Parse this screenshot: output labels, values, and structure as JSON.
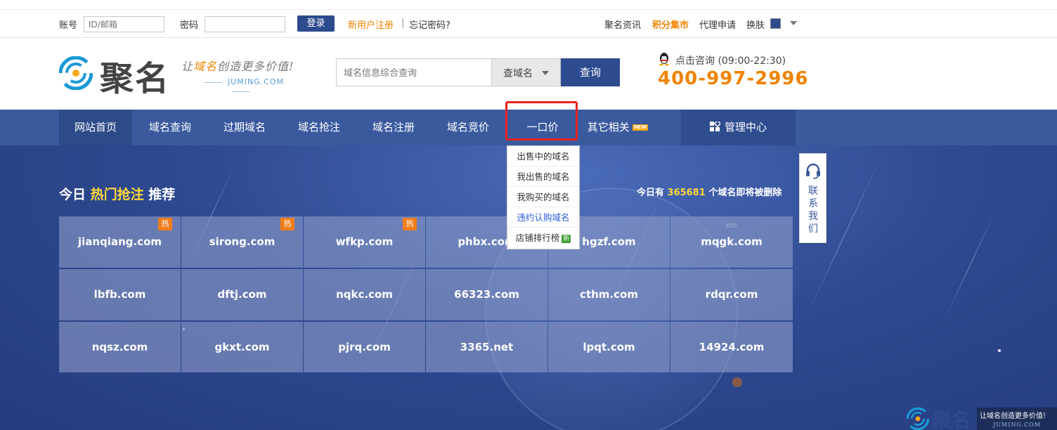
{
  "topbar": {
    "username_label": "账号",
    "username_placeholder": "ID/邮箱",
    "password_label": "密码",
    "login_button": "登录",
    "register_link": "新用户注册",
    "forgot_link": "忘记密码?",
    "news_link": "聚名资讯",
    "points_link": "积分集市",
    "agent_link": "代理申请",
    "skin_label": "换肤",
    "skin_color": "#2d4b8e"
  },
  "header": {
    "logo_text": "聚名",
    "slogan_prefix": "让",
    "slogan_highlight": "域名",
    "slogan_suffix": "创造更多价值!",
    "slogan_domain": "JUMING.COM",
    "search_placeholder": "域名信息综合查询",
    "search_type": "查域名",
    "search_button": "查询",
    "consult_text": "点击咨询",
    "consult_hours": "(09:00-22:30)",
    "phone": "400-997-2996"
  },
  "nav": {
    "items": [
      "网站首页",
      "域名查询",
      "过期域名",
      "域名抢注",
      "域名注册",
      "域名竞价",
      "一口价",
      "其它相关"
    ],
    "new_badge": "NEW",
    "manage": "管理中心"
  },
  "dropdown": {
    "items": [
      "出售中的域名",
      "我出售的域名",
      "我购买的域名",
      "违约认购域名",
      "店铺排行榜"
    ],
    "new_tag": "新"
  },
  "banner": {
    "title_prefix": "今日 ",
    "title_highlight": "热门抢注",
    "title_suffix": " 推荐",
    "count_prefix": "今日有 ",
    "count_value": "365681",
    "count_suffix": " 个域名即将被删除",
    "hot_tag": "热",
    "domains": [
      "jianqiang.com",
      "sirong.com",
      "wfkp.com",
      "phbx.com",
      "hgzf.com",
      "mqgk.com",
      "lbfb.com",
      "dftj.com",
      "nqkc.com",
      "66323.com",
      "cthm.com",
      "rdqr.com",
      "nqsz.com",
      "gkxt.com",
      "pjrq.com",
      "3365.net",
      "lpqt.com",
      "14924.com"
    ],
    "bg_text": "xin"
  },
  "contact": {
    "label": "联系我们"
  },
  "footer_logo": {
    "text": "聚名",
    "slogan": "让域名创造更多价值!",
    "domain": "JUMING.COM"
  },
  "colors": {
    "brand_blue": "#2d4b8e",
    "accent_orange": "#f08300",
    "highlight_red": "#e8231e"
  }
}
